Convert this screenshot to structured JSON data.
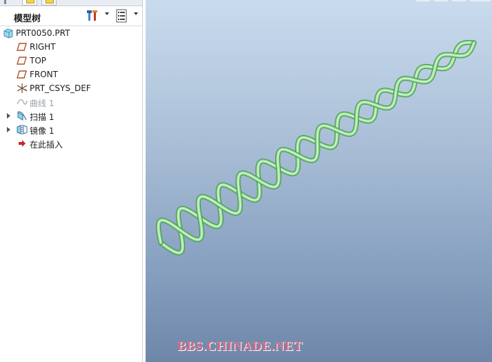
{
  "panel": {
    "title": "模型树"
  },
  "tree": {
    "items": [
      {
        "label": "PRT0050.PRT",
        "icon": "part-icon",
        "dim": false,
        "expandable": false
      },
      {
        "label": "RIGHT",
        "icon": "datum-plane-icon",
        "dim": false,
        "expandable": false
      },
      {
        "label": "TOP",
        "icon": "datum-plane-icon",
        "dim": false,
        "expandable": false
      },
      {
        "label": "FRONT",
        "icon": "datum-plane-icon",
        "dim": false,
        "expandable": false
      },
      {
        "label": "PRT_CSYS_DEF",
        "icon": "coordinate-system-icon",
        "dim": false,
        "expandable": false
      },
      {
        "label": "曲线 1",
        "icon": "curve-icon",
        "dim": true,
        "expandable": false
      },
      {
        "label": "扫描 1",
        "icon": "sweep-icon",
        "dim": false,
        "expandable": true
      },
      {
        "label": "镜像 1",
        "icon": "mirror-icon",
        "dim": false,
        "expandable": true
      },
      {
        "label": "在此插入",
        "icon": "insert-here-arrow-icon",
        "dim": false,
        "expandable": false
      }
    ]
  },
  "viewport": {
    "watermark": "BBS.CHINADE.NET",
    "model_color": "#8fd98f",
    "background_top": "#c9dbee",
    "background_bottom": "#6e87a9"
  }
}
